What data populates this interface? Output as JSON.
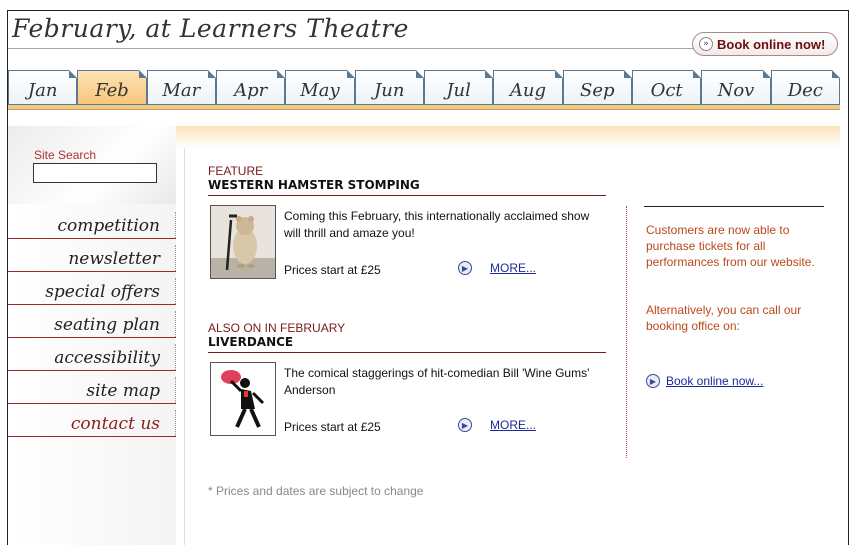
{
  "header": {
    "title": "February, at Learners Theatre",
    "book_button": "Book online now!"
  },
  "months": [
    {
      "label": "Jan",
      "active": false
    },
    {
      "label": "Feb",
      "active": true
    },
    {
      "label": "Mar",
      "active": false
    },
    {
      "label": "Apr",
      "active": false
    },
    {
      "label": "May",
      "active": false
    },
    {
      "label": "Jun",
      "active": false
    },
    {
      "label": "Jul",
      "active": false
    },
    {
      "label": "Aug",
      "active": false
    },
    {
      "label": "Sep",
      "active": false
    },
    {
      "label": "Oct",
      "active": false
    },
    {
      "label": "Nov",
      "active": false
    },
    {
      "label": "Dec",
      "active": false
    }
  ],
  "sidebar": {
    "search_label": "Site Search",
    "search_value": "",
    "items": [
      {
        "label": "competition"
      },
      {
        "label": "newsletter"
      },
      {
        "label": "special offers"
      },
      {
        "label": "seating plan"
      },
      {
        "label": "accessibility"
      },
      {
        "label": "site map"
      },
      {
        "label": "contact us"
      }
    ]
  },
  "feature": {
    "kicker": "FEATURE",
    "heading": "WESTERN HAMSTER STOMPING",
    "description": "Coming this February, this internationally acclaimed show will thrill and amaze you!",
    "price": "Prices start at £25",
    "more": "MORE..."
  },
  "also": {
    "kicker": "ALSO ON IN FEBRUARY",
    "heading": "LIVERDANCE",
    "description": "The comical staggerings of hit-comedian Bill 'Wine Gums' Anderson",
    "price": "Prices start at £25",
    "more": "MORE..."
  },
  "note": "* Prices and dates are subject to change",
  "side": {
    "para1": "Customers are now able to purchase tickets for all performances from our website.",
    "para2": "Alternatively, you can call our booking office on:",
    "link": "Book online now..."
  },
  "colors": {
    "accent_red": "#7a1a1a",
    "tab_active": "#f6c77d",
    "link_blue": "#1a2a9a",
    "side_text": "#b84a1a"
  }
}
